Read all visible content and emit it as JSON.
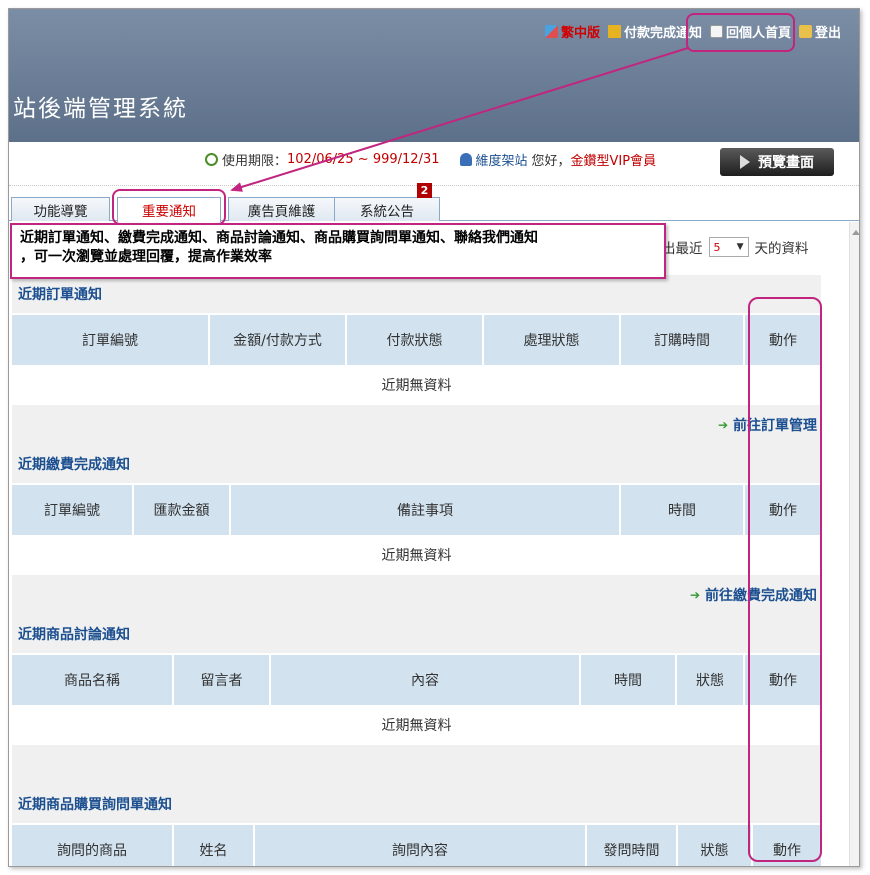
{
  "header": {
    "site_title": "站後端管理系統",
    "nav": {
      "lang": "繁中版",
      "payment_notice": "付款完成通知",
      "personal_home": "回個人首頁",
      "logout": "登出"
    }
  },
  "infobar": {
    "period_label": "使用期限：",
    "period_value": "102/06/25 ~ 999/12/31",
    "site_name": "維度架站",
    "greeting": "您好，",
    "member_level": "金鑽型VIP會員",
    "preview_button": "預覽畫面"
  },
  "tabs": [
    {
      "label": "功能導覽"
    },
    {
      "label": "重要通知"
    },
    {
      "label": "廣告頁維護"
    },
    {
      "label": "系統公告"
    }
  ],
  "badge_count": "2",
  "days_filter": {
    "prefix": "出最近",
    "value": "5",
    "suffix": "天的資料"
  },
  "callout": {
    "line1": "近期訂單通知、繳費完成通知、商品討論通知、商品購買詢問單通知、聯絡我們通知",
    "line2": "，可一次瀏覽並處理回覆，提高作業效率"
  },
  "sections": {
    "orders": {
      "title": "近期訂單通知",
      "columns": [
        "訂單編號",
        "金額/付款方式",
        "付款狀態",
        "處理狀態",
        "訂購時間",
        "動作"
      ],
      "empty": "近期無資料",
      "link": "前往訂單管理"
    },
    "payments": {
      "title": "近期繳費完成通知",
      "columns": [
        "訂單編號",
        "匯款金額",
        "備註事項",
        "時間",
        "動作"
      ],
      "empty": "近期無資料",
      "link": "前往繳費完成通知"
    },
    "discussions": {
      "title": "近期商品討論通知",
      "columns": [
        "商品名稱",
        "留言者",
        "內容",
        "時間",
        "狀態",
        "動作"
      ],
      "empty": "近期無資料"
    },
    "inquiries": {
      "title": "近期商品購買詢問單通知",
      "columns": [
        "詢問的商品",
        "姓名",
        "詢問內容",
        "發問時間",
        "狀態",
        "動作"
      ]
    }
  },
  "colors": {
    "header_bg": "#6b7e97",
    "accent_red": "#c00000",
    "link_blue": "#1b4f90",
    "annotation": "#c2257f",
    "table_header": "#d2e3ef"
  }
}
